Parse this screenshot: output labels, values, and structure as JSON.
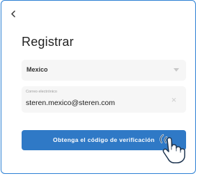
{
  "header": {
    "back_icon": "chevron-left-icon",
    "title": "Registrar"
  },
  "form": {
    "country_select": {
      "value": "Mexico",
      "caret_icon": "caret-down-icon"
    },
    "email": {
      "label": "Correo electrónico",
      "value": "steren.mexico@steren.com",
      "clear_icon": "close-icon"
    },
    "submit_label": "Obtenga el código de verificación"
  },
  "overlay": {
    "pointer_icon": "tap-hand-icon"
  },
  "colors": {
    "accent": "#2f79c6",
    "frame_border": "#2a7fd4",
    "field_bg": "#f6f6f6"
  }
}
